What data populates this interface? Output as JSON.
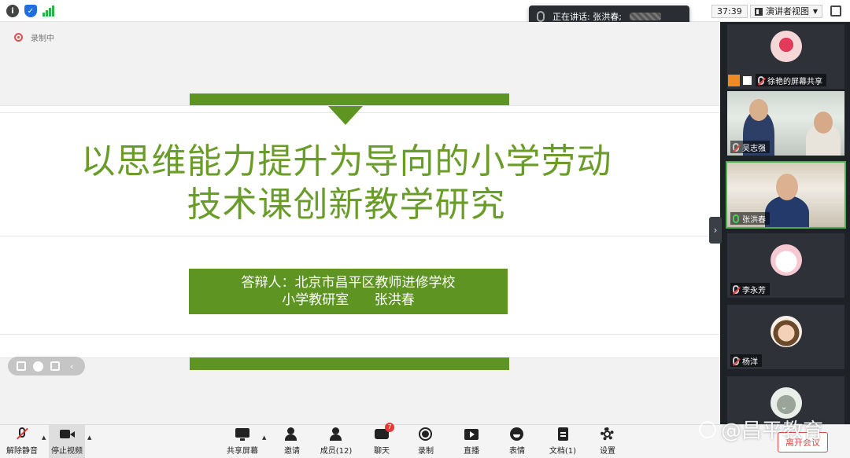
{
  "topbar": {
    "speaking_label": "正在讲话: 张洪春;",
    "timer": "37:39",
    "view_label": "演讲者视图"
  },
  "slide": {
    "recording_label": "录制中",
    "title_line1": "以思维能力提升为导向的小学劳动",
    "title_line2": "技术课创新教学研究",
    "presenter_line1": "答辩人：北京市昌平区教师进修学校",
    "presenter_line2": "小学教研室      张洪春",
    "accent_color": "#5e9421",
    "title_color": "#6a9c2a"
  },
  "participants": [
    {
      "name": "徐艳的屏幕共享",
      "mic": "muted"
    },
    {
      "name": "吴志强",
      "mic": "muted"
    },
    {
      "name": "张洪春",
      "mic": "live"
    },
    {
      "name": "李永芳",
      "mic": "muted"
    },
    {
      "name": "杨洋",
      "mic": "muted"
    }
  ],
  "toolbar": {
    "unmute": "解除静音",
    "stop_video": "停止视频",
    "share_screen": "共享屏幕",
    "invite": "邀请",
    "members": "成员(12)",
    "chat": "聊天",
    "chat_badge": "7",
    "record": "录制",
    "live": "直播",
    "reactions": "表情",
    "docs": "文档(1)",
    "settings": "设置",
    "leave": "离开会议"
  },
  "watermark": "@昌平教育"
}
